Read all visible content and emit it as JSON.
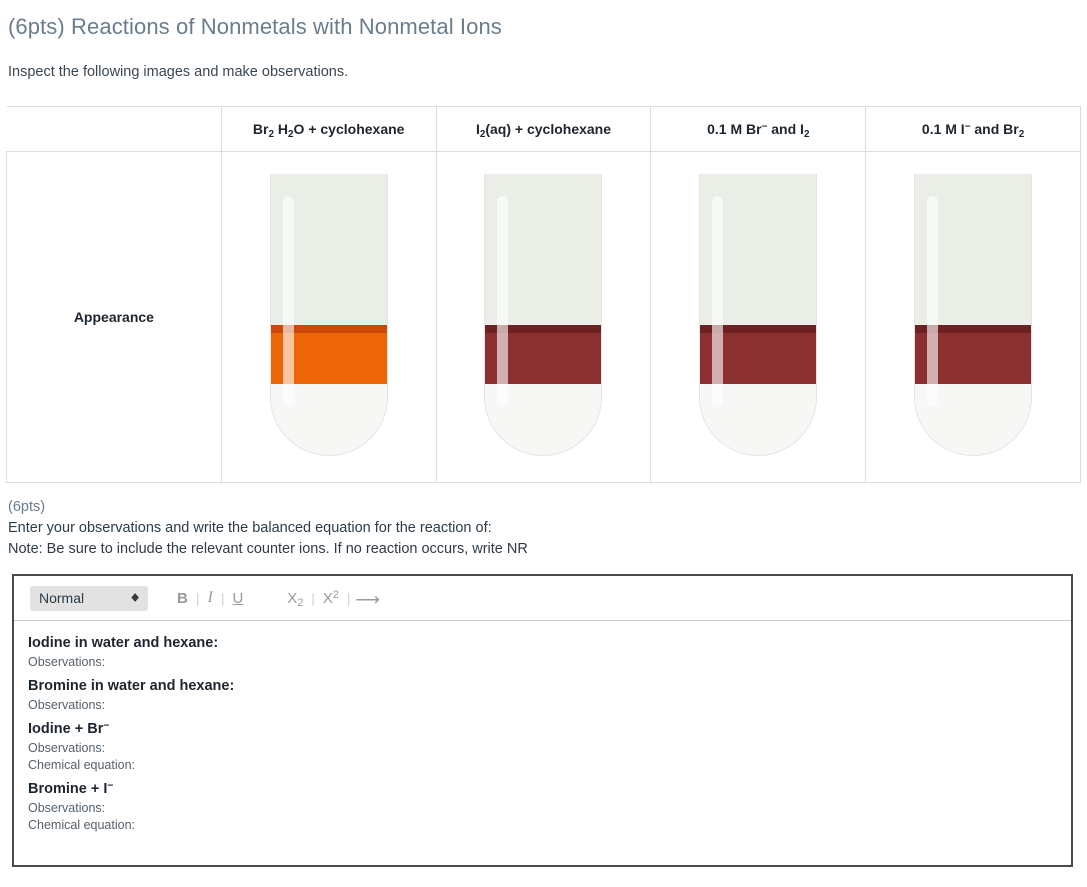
{
  "header": {
    "title": "(6pts) Reactions of Nonmetals with Nonmetal Ions",
    "intro": "Inspect the following images and make observations."
  },
  "table": {
    "label_column_header": "",
    "row_label": "Appearance",
    "columns": [
      {
        "id": "br2-water-cyclohexane",
        "header_parts": [
          "Br",
          "2",
          " H",
          "2",
          "O + cyclohexane"
        ],
        "header_plain": "Br2 H2O + cyclohexane"
      },
      {
        "id": "i2-aq-cyclohexane",
        "header_parts": [
          "I",
          "2",
          "(aq) + cyclohexane"
        ],
        "header_plain": "I2(aq) + cyclohexane"
      },
      {
        "id": "br-minus-and-i2",
        "header_parts": [
          "0.1 M Br",
          "−",
          " and I",
          "2"
        ],
        "header_plain": "0.1 M Br- and I2"
      },
      {
        "id": "i-minus-and-br2",
        "header_parts": [
          "0.1 M I",
          "−",
          " and Br",
          "2"
        ],
        "header_plain": "0.1 M I- and Br2"
      }
    ],
    "tubes": [
      {
        "name": "test-tube-br2-water-cyclohexane",
        "liquid_color": "#ec6608",
        "rim_color": "#c9490a",
        "glass_color": "#eaeee6",
        "lower_color": "#f7f8f6",
        "liquid_top_pct": 54,
        "liquid_height_pct": 21
      },
      {
        "name": "test-tube-i2-aq-cyclohexane",
        "liquid_color": "#8c2f31",
        "rim_color": "#6e2123",
        "glass_color": "#eaeee6",
        "lower_color": "#f7f8f6",
        "liquid_top_pct": 54,
        "liquid_height_pct": 21
      },
      {
        "name": "test-tube-br-minus-and-i2",
        "liquid_color": "#8c2f31",
        "rim_color": "#6e2123",
        "glass_color": "#eaeee6",
        "lower_color": "#f7f8f6",
        "liquid_top_pct": 54,
        "liquid_height_pct": 21
      },
      {
        "name": "test-tube-i-minus-and-br2",
        "liquid_color": "#8c2f31",
        "rim_color": "#6e2123",
        "glass_color": "#eaeee6",
        "lower_color": "#f7f8f6",
        "liquid_top_pct": 54,
        "liquid_height_pct": 21
      }
    ]
  },
  "prompt": {
    "points": "(6pts)",
    "line1": "Enter your observations and write the balanced equation for the reaction of:",
    "line2": "Note: Be sure to include the relevant counter ions. If no reaction occurs, write NR"
  },
  "editor": {
    "toolbar": {
      "format_value": "Normal",
      "format_caret": "↕",
      "bold_label": "B",
      "italic_label": "I",
      "underline_label": "U",
      "separator": "|",
      "subscript_base": "X",
      "subscript_index": "2",
      "superscript_base": "X",
      "superscript_index": "2",
      "arrow_label": "⟶"
    },
    "content": [
      {
        "heading": "Iodine in water and hexane:",
        "lines": [
          "Observations:"
        ]
      },
      {
        "heading": "Bromine in water and hexane:",
        "lines": [
          "Observations:"
        ]
      },
      {
        "heading_parts": [
          "Iodine + Br",
          "−"
        ],
        "heading": "Iodine + Br−",
        "lines": [
          "Observations:",
          "Chemical equation:"
        ]
      },
      {
        "heading_parts": [
          "Bromine + I",
          "−"
        ],
        "heading": "Bromine + I−",
        "lines": [
          "Observations:",
          "Chemical equation:"
        ]
      }
    ]
  }
}
